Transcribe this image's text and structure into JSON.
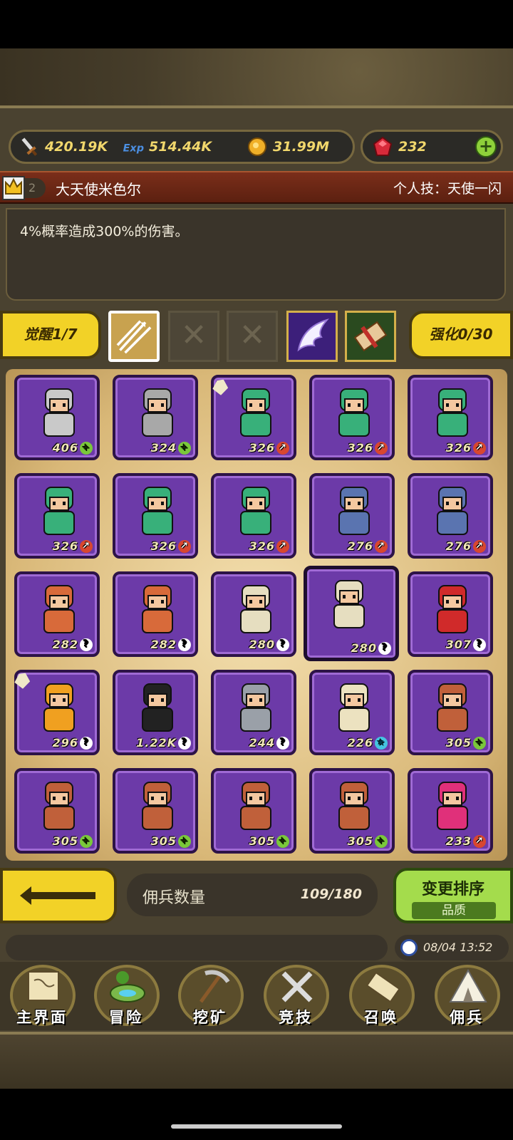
{
  "resources": {
    "attack": "420.19K",
    "exp": "514.44K",
    "gold": "31.99M",
    "gems": "232"
  },
  "hero": {
    "rank": "2",
    "name": "大天使米色尔",
    "skill": "个人技：天使一闪",
    "description": "4%概率造成300%的伤害。"
  },
  "awaken": {
    "label": "觉醒1/7"
  },
  "enhance": {
    "label": "强化0/30"
  },
  "cards": [
    {
      "level": "406",
      "badge": "+",
      "badge_type": "plus",
      "color": "#c9c9c9"
    },
    {
      "level": "324",
      "badge": "+",
      "badge_type": "plus",
      "color": "#a8a8a8"
    },
    {
      "level": "326",
      "badge": "↗",
      "badge_type": "arrow",
      "color": "#38b07a"
    },
    {
      "level": "326",
      "badge": "↗",
      "badge_type": "arrow",
      "color": "#38b07a"
    },
    {
      "level": "326",
      "badge": "↗",
      "badge_type": "arrow",
      "color": "#38b07a"
    },
    {
      "level": "326",
      "badge": "↗",
      "badge_type": "arrow",
      "color": "#38b07a"
    },
    {
      "level": "326",
      "badge": "↗",
      "badge_type": "arrow",
      "color": "#38b07a"
    },
    {
      "level": "326",
      "badge": "↗",
      "badge_type": "arrow",
      "color": "#38b07a"
    },
    {
      "level": "276",
      "badge": "↗",
      "badge_type": "arrow",
      "color": "#5a74b0"
    },
    {
      "level": "276",
      "badge": "↗",
      "badge_type": "arrow",
      "color": "#5a74b0"
    },
    {
      "level": "282",
      "badge": "?",
      "badge_type": "q",
      "color": "#d86a3a"
    },
    {
      "level": "282",
      "badge": "?",
      "badge_type": "q",
      "color": "#d86a3a"
    },
    {
      "level": "280",
      "badge": "?",
      "badge_type": "q",
      "color": "#e6dec0"
    },
    {
      "level": "280",
      "badge": "?",
      "badge_type": "q",
      "color": "#e6dec0"
    },
    {
      "level": "307",
      "badge": "?",
      "badge_type": "q",
      "color": "#d02a2a"
    },
    {
      "level": "296",
      "badge": "?",
      "badge_type": "q",
      "color": "#f0a020"
    },
    {
      "level": "1.22K",
      "badge": "?",
      "badge_type": "q",
      "color": "#222222"
    },
    {
      "level": "244",
      "badge": "?",
      "badge_type": "q",
      "color": "#9aa0a8"
    },
    {
      "level": "226",
      "badge": "★",
      "badge_type": "star",
      "color": "#ece2c0"
    },
    {
      "level": "305",
      "badge": "+",
      "badge_type": "plus",
      "color": "#c0603a"
    },
    {
      "level": "305",
      "badge": "+",
      "badge_type": "plus",
      "color": "#c0603a"
    },
    {
      "level": "305",
      "badge": "+",
      "badge_type": "plus",
      "color": "#c0603a"
    },
    {
      "level": "305",
      "badge": "+",
      "badge_type": "plus",
      "color": "#c0603a"
    },
    {
      "level": "305",
      "badge": "+",
      "badge_type": "plus",
      "color": "#c0603a"
    },
    {
      "level": "233",
      "badge": "↗",
      "badge_type": "arrow",
      "color": "#e0307a"
    }
  ],
  "mercenary": {
    "label": "佣兵数量",
    "count": "109/180"
  },
  "sort": {
    "title": "变更排序",
    "current": "品质"
  },
  "time": "08/04 13:52",
  "nav": {
    "home": "主界面",
    "adventure": "冒险",
    "mining": "挖矿",
    "arena": "竞技",
    "summon": "召唤",
    "mercenary": "佣兵"
  }
}
